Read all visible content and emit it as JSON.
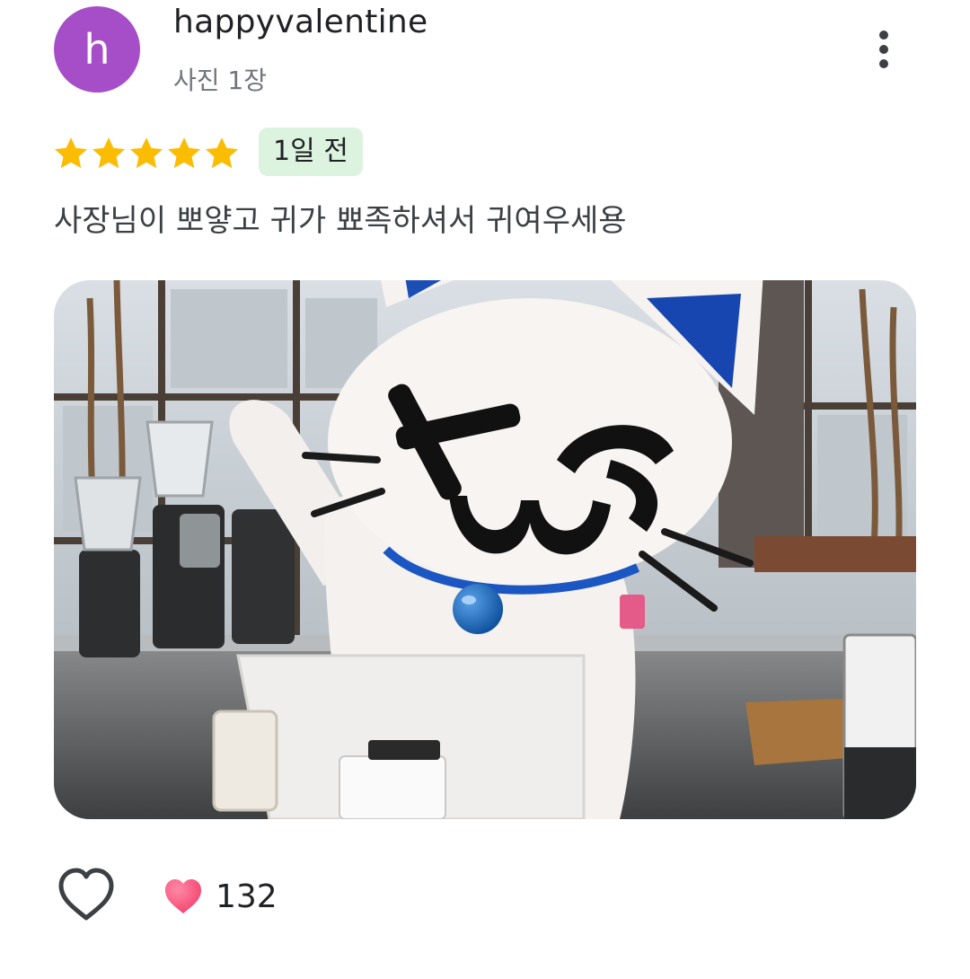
{
  "review": {
    "avatar_letter": "h",
    "avatar_color": "#a54ec8",
    "username": "happyvalentine",
    "photo_count": "사진 1장",
    "rating": 5,
    "max_rating": 5,
    "star_color": "#fbbc04",
    "time_ago": "1일 전",
    "text": "사장님이 뽀얗고 귀가 뾰족하셔서 귀여우세용",
    "photo_alt": "TWS 고양이 캐릭터 탈이 카페 카운터에서 인사하는 사진"
  },
  "actions": {
    "more_icon": "more-vert-icon",
    "like_icon": "heart-outline-icon",
    "reaction_icon": "heart-filled-icon",
    "reaction_count": "132"
  }
}
